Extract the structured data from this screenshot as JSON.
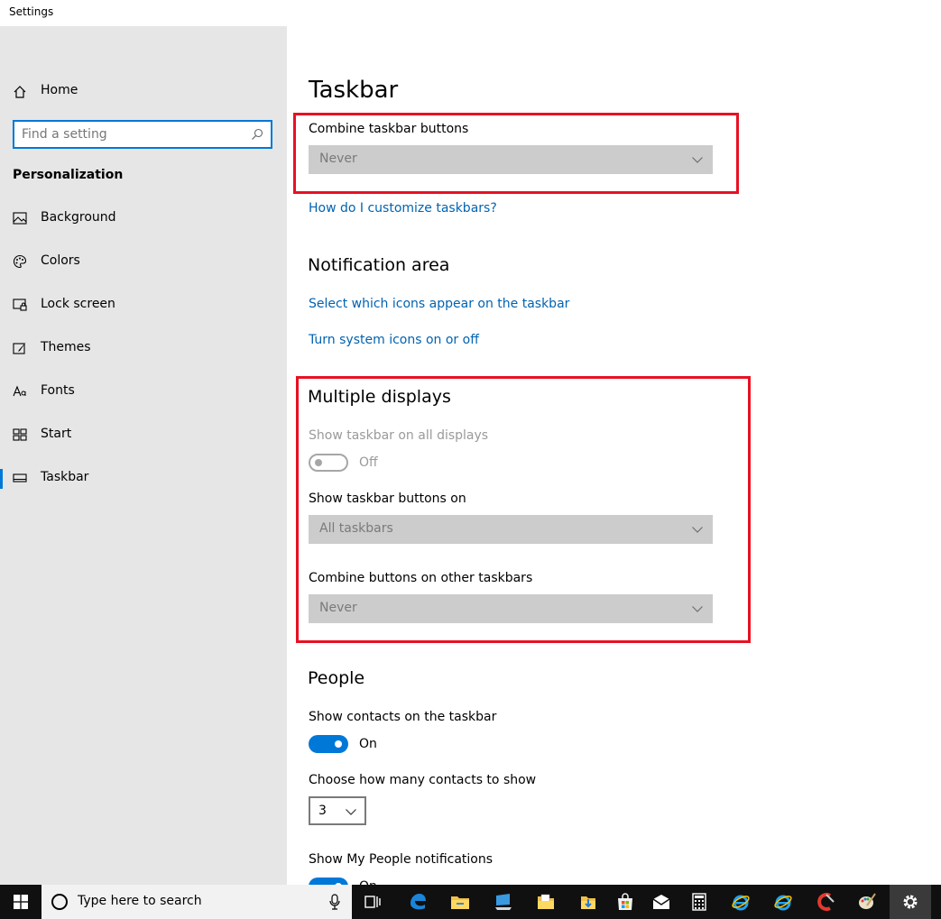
{
  "window": {
    "title": "Settings"
  },
  "sidebar": {
    "home": "Home",
    "search_placeholder": "Find a setting",
    "section": "Personalization",
    "items": [
      {
        "label": "Background",
        "icon": "picture-icon"
      },
      {
        "label": "Colors",
        "icon": "palette-icon"
      },
      {
        "label": "Lock screen",
        "icon": "lock-screen-icon"
      },
      {
        "label": "Themes",
        "icon": "brush-icon"
      },
      {
        "label": "Fonts",
        "icon": "font-icon"
      },
      {
        "label": "Start",
        "icon": "start-tiles-icon"
      },
      {
        "label": "Taskbar",
        "icon": "taskbar-icon",
        "active": true
      }
    ]
  },
  "main": {
    "title": "Taskbar",
    "combine": {
      "label": "Combine taskbar buttons",
      "value": "Never",
      "help_link": "How do I customize taskbars?"
    },
    "notification": {
      "heading": "Notification area",
      "link1": "Select which icons appear on the taskbar",
      "link2": "Turn system icons on or off"
    },
    "multiple": {
      "heading": "Multiple displays",
      "show_all_label": "Show taskbar on all displays",
      "show_all_state": "Off",
      "buttons_on_label": "Show taskbar buttons on",
      "buttons_on_value": "All taskbars",
      "combine_other_label": "Combine buttons on other taskbars",
      "combine_other_value": "Never"
    },
    "people": {
      "heading": "People",
      "contacts_label": "Show contacts on the taskbar",
      "contacts_state": "On",
      "count_label": "Choose how many contacts to show",
      "count_value": "3",
      "notif_label": "Show My People notifications",
      "notif_state": "On"
    }
  },
  "taskbar": {
    "search_text": "Type here to search",
    "icons": [
      "task-view-icon",
      "edge-icon",
      "file-explorer-icon",
      "computer-icon",
      "folder-icon",
      "download-folder-icon",
      "store-icon",
      "mail-icon",
      "calculator-icon",
      "ie-icon",
      "ie-icon",
      "ccleaner-icon",
      "paint-icon",
      "settings-gear-icon"
    ]
  },
  "colors": {
    "accent": "#0078d7",
    "link": "#0063b1",
    "highlight_box": "#e81123",
    "sidebar_bg": "#e6e6e6",
    "dropdown_bg": "#cccccc",
    "taskbar_bg": "#101010"
  }
}
